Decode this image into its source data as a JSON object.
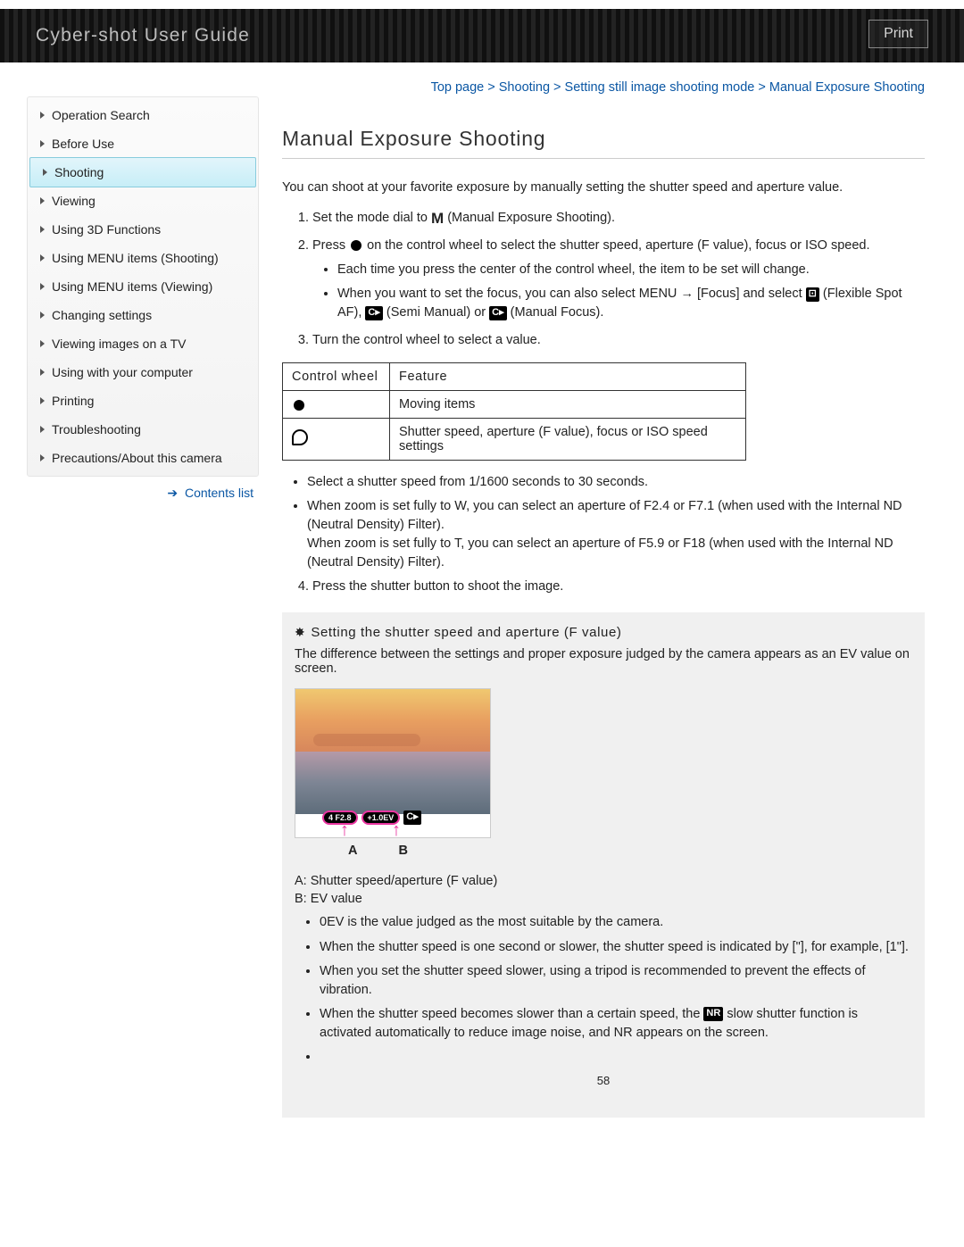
{
  "header": {
    "title": "Cyber-shot User Guide",
    "print": "Print"
  },
  "breadcrumb": {
    "items": [
      "Top page",
      "Shooting",
      "Setting still image shooting mode",
      "Manual Exposure Shooting"
    ]
  },
  "sidebar": {
    "items": [
      {
        "label": "Operation Search"
      },
      {
        "label": "Before Use"
      },
      {
        "label": "Shooting",
        "active": true
      },
      {
        "label": "Viewing"
      },
      {
        "label": "Using 3D Functions"
      },
      {
        "label": "Using MENU items (Shooting)"
      },
      {
        "label": "Using MENU items (Viewing)"
      },
      {
        "label": "Changing settings"
      },
      {
        "label": "Viewing images on a TV"
      },
      {
        "label": "Using with your computer"
      },
      {
        "label": "Printing"
      },
      {
        "label": "Troubleshooting"
      },
      {
        "label": "Precautions/About this camera"
      }
    ],
    "contents_list": "Contents list"
  },
  "page_title": "Manual Exposure Shooting",
  "intro": "You can shoot at your favorite exposure by manually setting the shutter speed and aperture value.",
  "steps": {
    "s1_a": "Set the mode dial to ",
    "s1_b": "(Manual Exposure Shooting).",
    "s2_a": "Press ",
    "s2_b": " on the control wheel to select the shutter speed, aperture (F value), focus or ISO speed.",
    "s2_sub1": "Each time you press the center of the control wheel, the item to be set will change.",
    "s2_sub2_a": "When you want to set the focus, you can also select MENU ",
    "s2_sub2_b": " [Focus] and select ",
    "s2_sub2_c": " (Flexible Spot AF), ",
    "s2_sub2_d": "(Semi Manual) or ",
    "s2_sub2_e": "(Manual Focus).",
    "s3": "Turn the control wheel to select a value.",
    "s4": "Press the shutter button to shoot the image."
  },
  "table": {
    "h1": "Control wheel",
    "h2": "Feature",
    "r1": "Moving items",
    "r2": "Shutter speed, aperture (F value), focus or ISO speed settings"
  },
  "post_table": {
    "b1": "Select a shutter speed from 1/1600 seconds to 30 seconds.",
    "b2": "When zoom is set fully to W, you can select an aperture of F2.4 or F7.1 (when used with the Internal ND (Neutral Density) Filter).",
    "b2_cont": "When zoom is set fully to T, you can select an aperture of F5.9 or F18 (when used with the Internal ND (Neutral Density) Filter)."
  },
  "tip": {
    "heading": "Setting the shutter speed and aperture (F value)",
    "desc": "The difference between the settings and proper exposure judged by the camera appears as an EV value on screen.",
    "osd_a": "4 F2.8",
    "osd_b": "+1.0EV",
    "lab_a": "A",
    "lab_b": "B",
    "defA": "A: Shutter speed/aperture (F value)",
    "defB": "B: EV value",
    "bullets": [
      "0EV is the value judged as the most suitable by the camera.",
      "When the shutter speed is one second or slower, the shutter speed is indicated by [\"], for example, [1\"].",
      "When you set the shutter speed slower, using a tripod is recommended to prevent the effects of vibration.",
      "When the shutter speed becomes slower than a certain speed, the NR slow shutter function is activated automatically to reduce image noise, and NR appears on the screen."
    ],
    "nr_icon": "NR"
  },
  "page_number": "58"
}
